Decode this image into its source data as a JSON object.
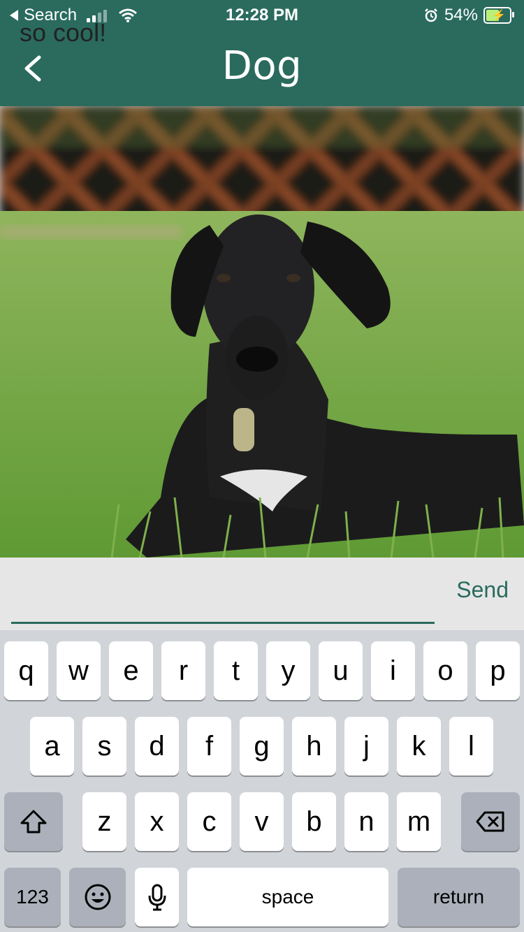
{
  "status_bar": {
    "back_app": "Search",
    "time": "12:28 PM",
    "battery_pct": "54%"
  },
  "nav": {
    "title": "Dog",
    "back_icon": "chevron-left-icon"
  },
  "comment": {
    "text": "so cool!",
    "send_label": "Send"
  },
  "keyboard": {
    "row1": [
      "q",
      "w",
      "e",
      "r",
      "t",
      "y",
      "u",
      "i",
      "o",
      "p"
    ],
    "row2": [
      "a",
      "s",
      "d",
      "f",
      "g",
      "h",
      "j",
      "k",
      "l"
    ],
    "row3": [
      "z",
      "x",
      "c",
      "v",
      "b",
      "n",
      "m"
    ],
    "numbers_label": "123",
    "space_label": "space",
    "return_label": "return"
  },
  "colors": {
    "header_bg": "#2a6b5e",
    "accent": "#2a6b5e"
  }
}
